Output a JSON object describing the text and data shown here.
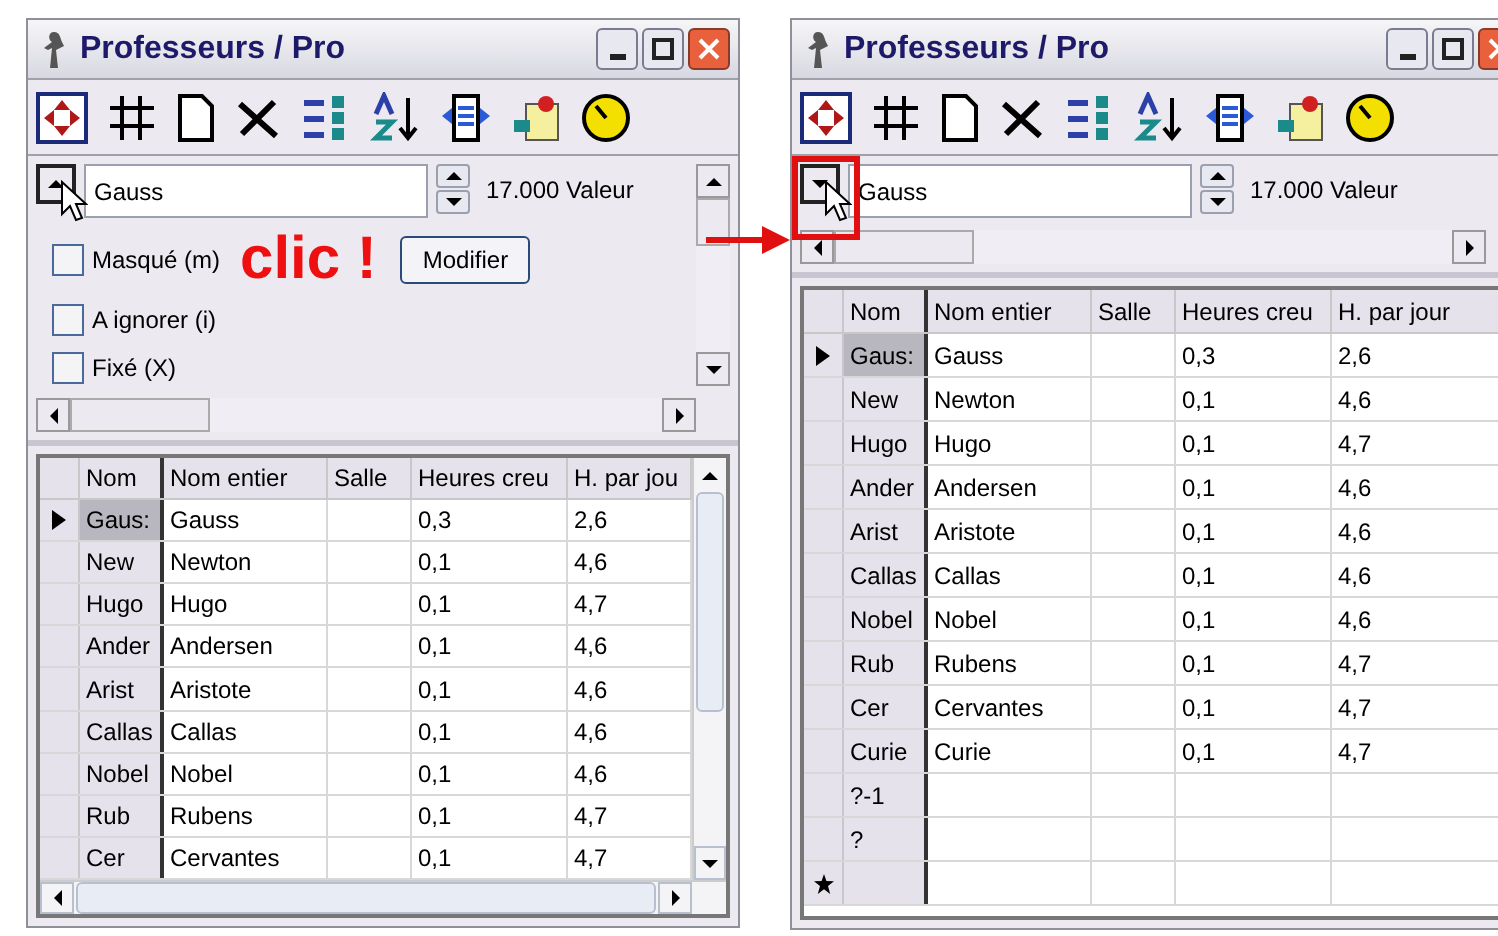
{
  "windows": [
    {
      "title": "Professeurs / Pro",
      "editor": {
        "value": "Gauss",
        "reading": "17.000 Valeur",
        "expanded": true,
        "button": "Modifier",
        "checkboxes": [
          {
            "label": "Masqué (m)",
            "checked": false
          },
          {
            "label": "A ignorer (i)",
            "checked": false
          },
          {
            "label": "Fixé (X)",
            "checked": false
          }
        ]
      },
      "table": {
        "columns": [
          "Nom",
          "Nom entier",
          "Salle",
          "Heures creu",
          "H. par jou"
        ],
        "rows": [
          {
            "kind": "record",
            "selected": true,
            "nom": "Gaus:",
            "nom_entier": "Gauss",
            "heures": "0,3",
            "h_par_jour": "2,6"
          },
          {
            "kind": "record",
            "selected": false,
            "nom": "New",
            "nom_entier": "Newton",
            "heures": "0,1",
            "h_par_jour": "4,6"
          },
          {
            "kind": "record",
            "selected": false,
            "nom": "Hugo",
            "nom_entier": "Hugo",
            "heures": "0,1",
            "h_par_jour": "4,7"
          },
          {
            "kind": "record",
            "selected": false,
            "nom": "Ander",
            "nom_entier": "Andersen",
            "heures": "0,1",
            "h_par_jour": "4,6"
          },
          {
            "kind": "record",
            "selected": false,
            "nom": "Arist",
            "nom_entier": "Aristote",
            "heures": "0,1",
            "h_par_jour": "4,6"
          },
          {
            "kind": "record",
            "selected": false,
            "nom": "Callas",
            "nom_entier": "Callas",
            "heures": "0,1",
            "h_par_jour": "4,6"
          },
          {
            "kind": "record",
            "selected": false,
            "nom": "Nobel",
            "nom_entier": "Nobel",
            "heures": "0,1",
            "h_par_jour": "4,6"
          },
          {
            "kind": "record",
            "selected": false,
            "nom": "Rub",
            "nom_entier": "Rubens",
            "heures": "0,1",
            "h_par_jour": "4,7"
          },
          {
            "kind": "record",
            "selected": false,
            "nom": "Cer",
            "nom_entier": "Cervantes",
            "heures": "0,1",
            "h_par_jour": "4,7"
          }
        ]
      }
    },
    {
      "title": "Professeurs / Pro",
      "editor": {
        "value": "Gauss",
        "reading": "17.000 Valeur",
        "expanded": false
      },
      "table": {
        "columns": [
          "Nom",
          "Nom entier",
          "Salle",
          "Heures creu",
          "H. par jour"
        ],
        "rows": [
          {
            "kind": "record",
            "selected": true,
            "nom": "Gaus:",
            "nom_entier": "Gauss",
            "heures": "0,3",
            "h_par_jour": "2,6"
          },
          {
            "kind": "record",
            "selected": false,
            "nom": "New",
            "nom_entier": "Newton",
            "heures": "0,1",
            "h_par_jour": "4,6"
          },
          {
            "kind": "record",
            "selected": false,
            "nom": "Hugo",
            "nom_entier": "Hugo",
            "heures": "0,1",
            "h_par_jour": "4,7"
          },
          {
            "kind": "record",
            "selected": false,
            "nom": "Ander",
            "nom_entier": "Andersen",
            "heures": "0,1",
            "h_par_jour": "4,6"
          },
          {
            "kind": "record",
            "selected": false,
            "nom": "Arist",
            "nom_entier": "Aristote",
            "heures": "0,1",
            "h_par_jour": "4,6"
          },
          {
            "kind": "record",
            "selected": false,
            "nom": "Callas",
            "nom_entier": "Callas",
            "heures": "0,1",
            "h_par_jour": "4,6"
          },
          {
            "kind": "record",
            "selected": false,
            "nom": "Nobel",
            "nom_entier": "Nobel",
            "heures": "0,1",
            "h_par_jour": "4,6"
          },
          {
            "kind": "record",
            "selected": false,
            "nom": "Rub",
            "nom_entier": "Rubens",
            "heures": "0,1",
            "h_par_jour": "4,7"
          },
          {
            "kind": "record",
            "selected": false,
            "nom": "Cer",
            "nom_entier": "Cervantes",
            "heures": "0,1",
            "h_par_jour": "4,7"
          },
          {
            "kind": "record",
            "selected": false,
            "nom": "Curie",
            "nom_entier": "Curie",
            "heures": "0,1",
            "h_par_jour": "4,7"
          },
          {
            "kind": "record",
            "selected": false,
            "nom": "?-1"
          },
          {
            "kind": "record",
            "selected": false,
            "nom": "?"
          },
          {
            "kind": "new",
            "selected": false
          }
        ]
      }
    }
  ],
  "annotation": {
    "callout": "clic !"
  }
}
